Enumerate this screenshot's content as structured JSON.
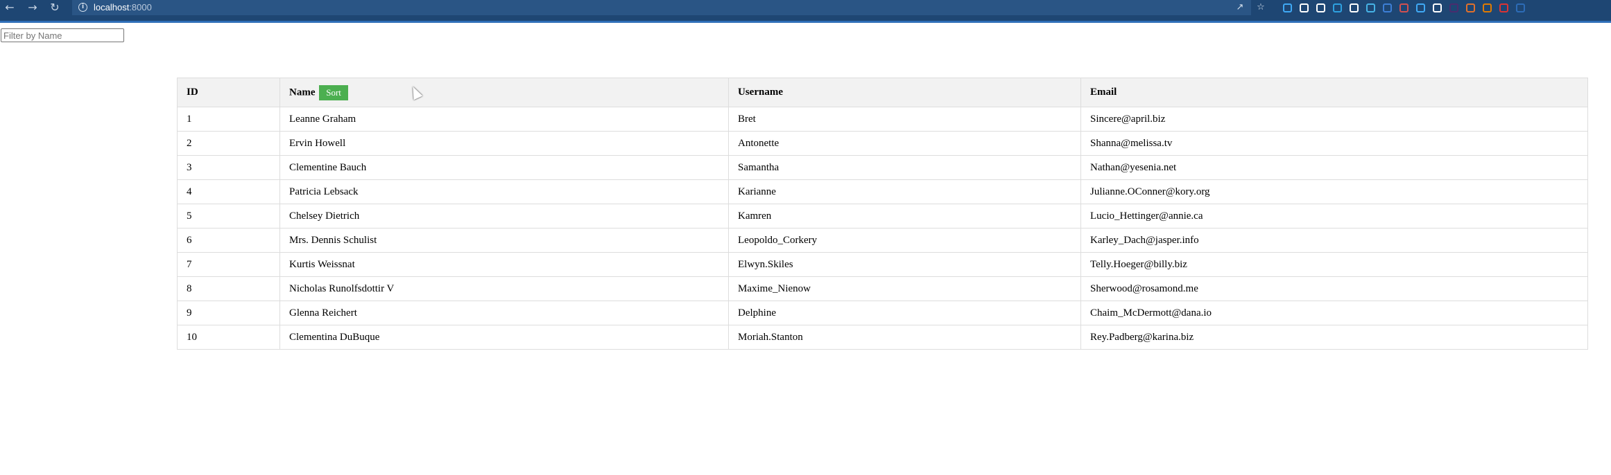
{
  "browser": {
    "url_host": "localhost",
    "url_port": ":8000",
    "extension_icon_colors": [
      "#3fa9f5",
      "#ffffff",
      "#ffffff",
      "#2ea1e0",
      "#ffffff",
      "#46b3e6",
      "#3d7fd6",
      "#d25050",
      "#3fa9f5",
      "#ffffff",
      "#4a2c6e",
      "#e2702a",
      "#e07b00",
      "#d33",
      "#2d6cb7"
    ]
  },
  "filter": {
    "placeholder": "Filter by Name",
    "value": ""
  },
  "table": {
    "headers": {
      "id": "ID",
      "name": "Name",
      "username": "Username",
      "email": "Email"
    },
    "sort_label": "Sort",
    "rows": [
      {
        "id": "1",
        "name": "Leanne Graham",
        "username": "Bret",
        "email": "Sincere@april.biz"
      },
      {
        "id": "2",
        "name": "Ervin Howell",
        "username": "Antonette",
        "email": "Shanna@melissa.tv"
      },
      {
        "id": "3",
        "name": "Clementine Bauch",
        "username": "Samantha",
        "email": "Nathan@yesenia.net"
      },
      {
        "id": "4",
        "name": "Patricia Lebsack",
        "username": "Karianne",
        "email": "Julianne.OConner@kory.org"
      },
      {
        "id": "5",
        "name": "Chelsey Dietrich",
        "username": "Kamren",
        "email": "Lucio_Hettinger@annie.ca"
      },
      {
        "id": "6",
        "name": "Mrs. Dennis Schulist",
        "username": "Leopoldo_Corkery",
        "email": "Karley_Dach@jasper.info"
      },
      {
        "id": "7",
        "name": "Kurtis Weissnat",
        "username": "Elwyn.Skiles",
        "email": "Telly.Hoeger@billy.biz"
      },
      {
        "id": "8",
        "name": "Nicholas Runolfsdottir V",
        "username": "Maxime_Nienow",
        "email": "Sherwood@rosamond.me"
      },
      {
        "id": "9",
        "name": "Glenna Reichert",
        "username": "Delphine",
        "email": "Chaim_McDermott@dana.io"
      },
      {
        "id": "10",
        "name": "Clementina DuBuque",
        "username": "Moriah.Stanton",
        "email": "Rey.Padberg@karina.biz"
      }
    ]
  },
  "colors": {
    "chrome_bg": "#1e4673",
    "sort_button": "#4caf50",
    "header_bg": "#f2f2f2",
    "border": "#dddddd"
  }
}
